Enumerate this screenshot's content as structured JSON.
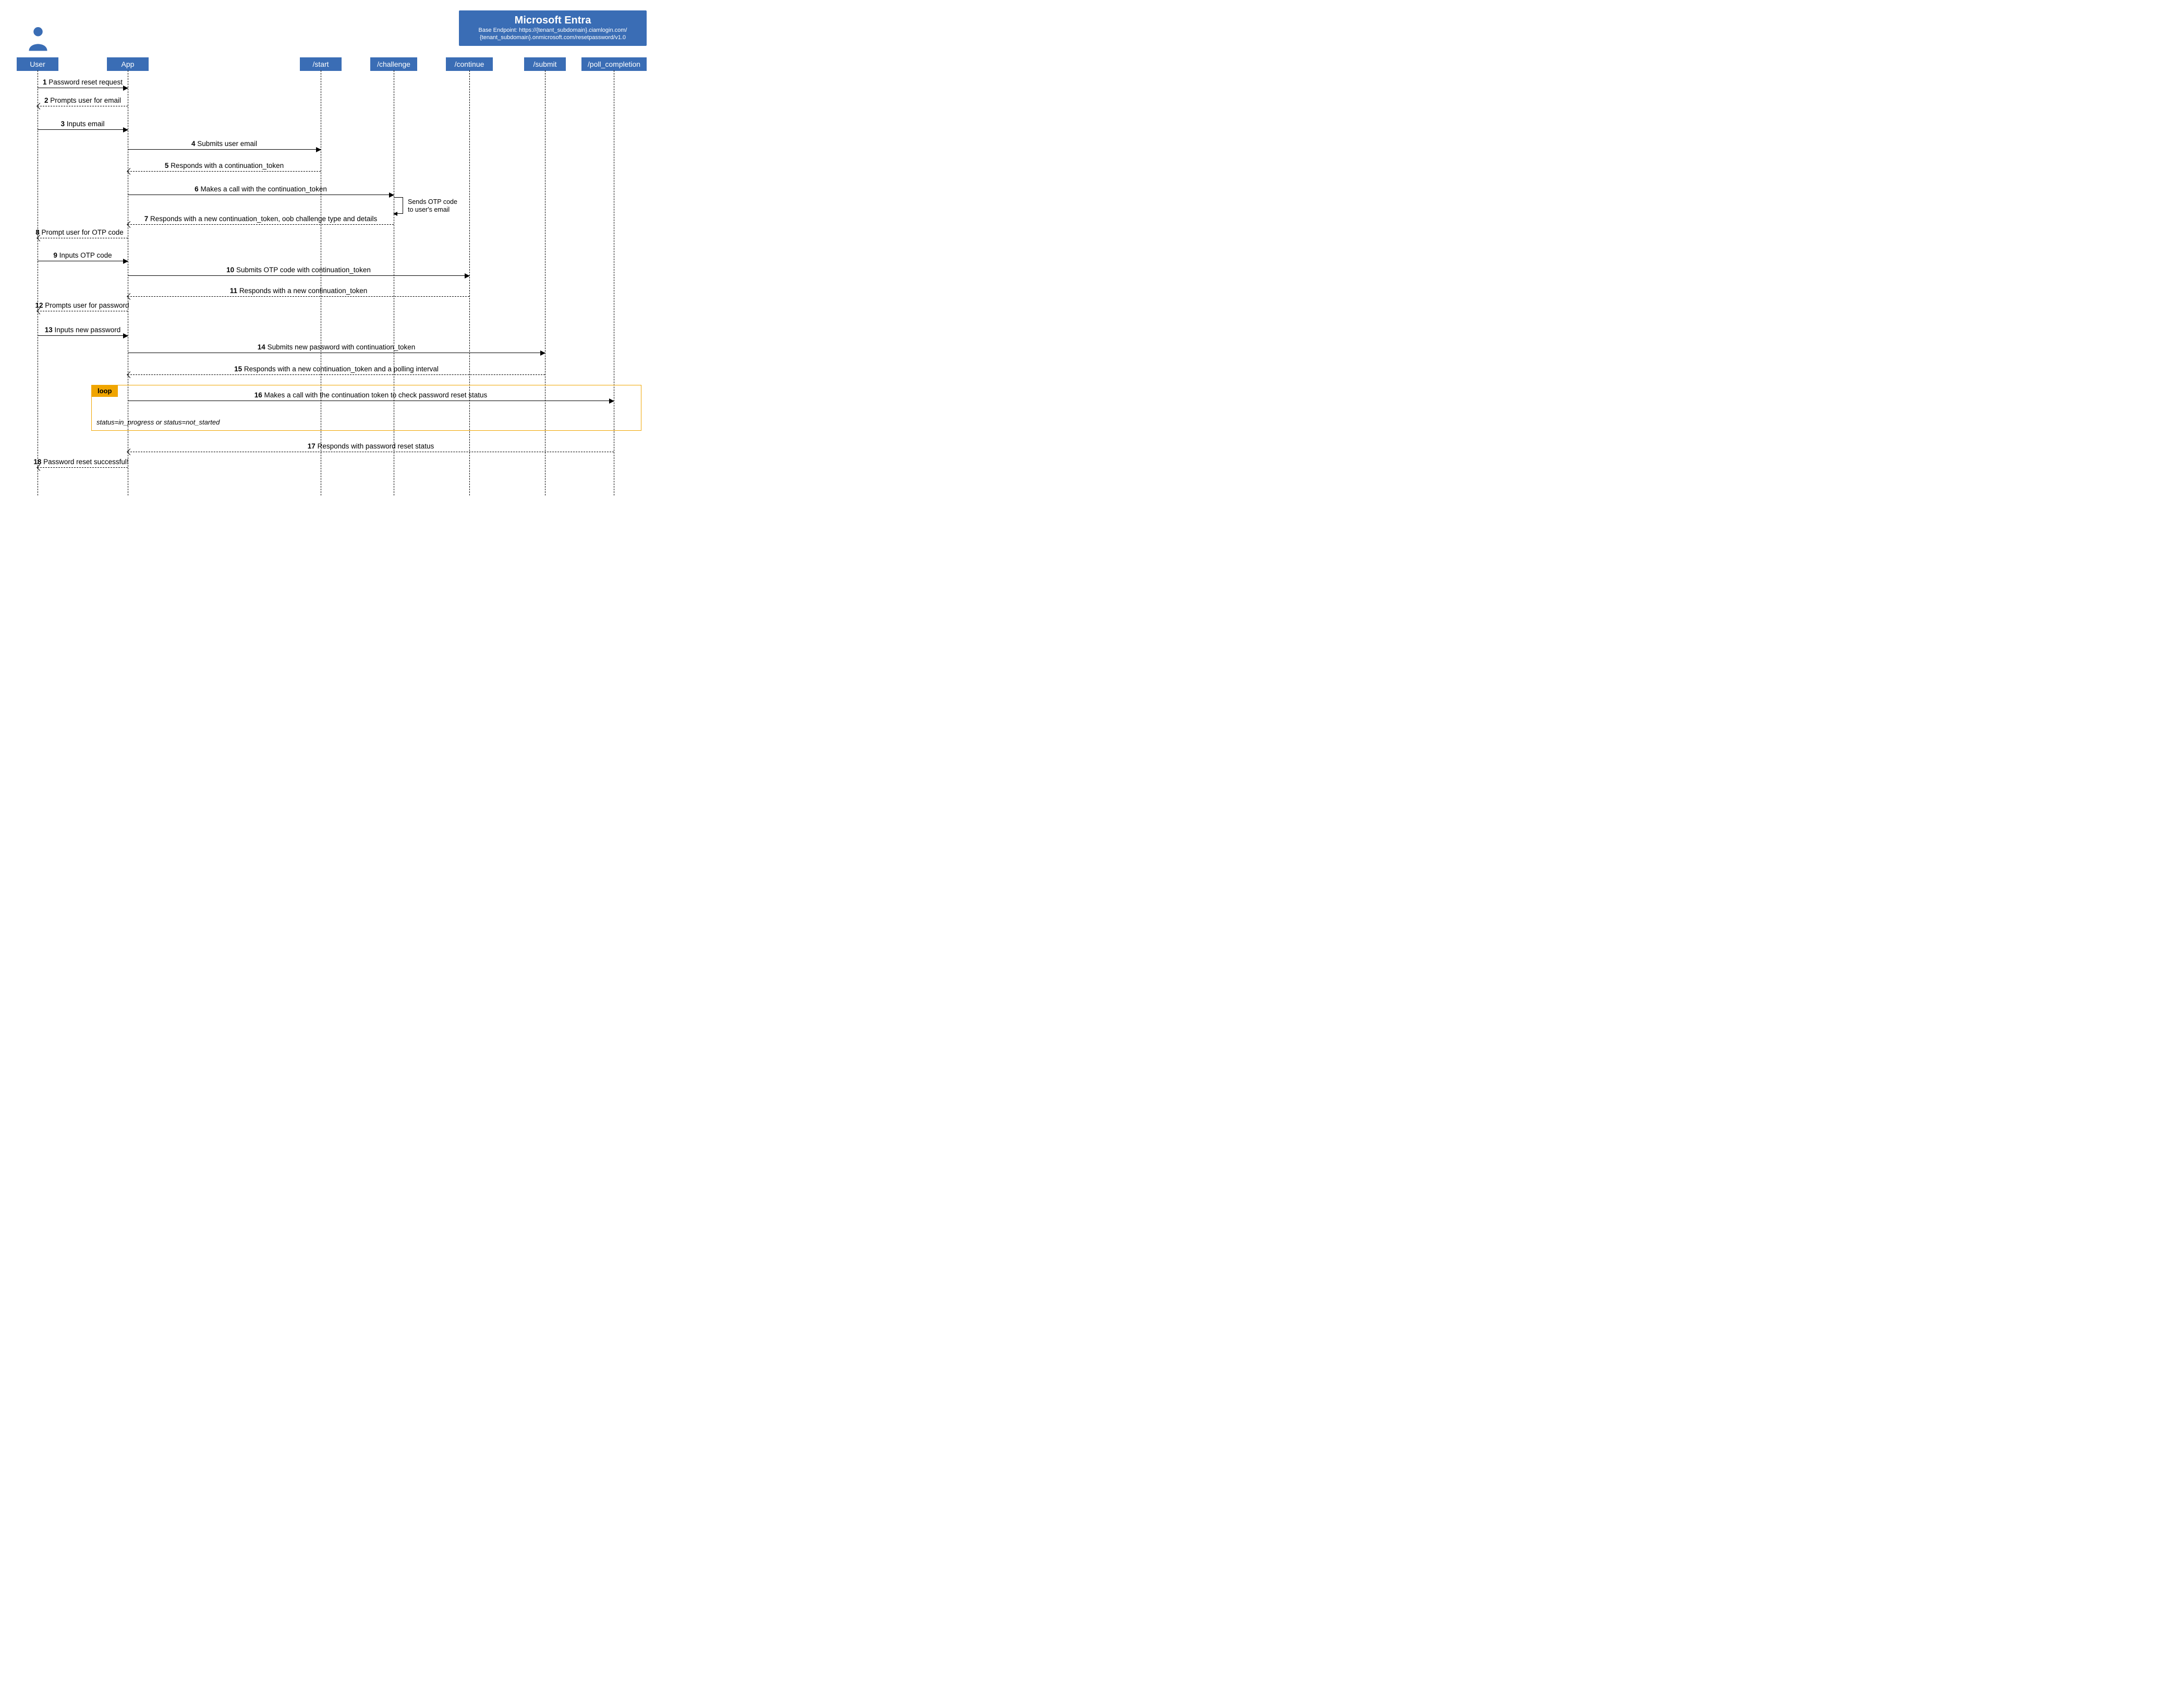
{
  "header": {
    "title": "Microsoft Entra",
    "sub1": "Base Endpoint: https://{tenant_subdomain}.ciamlogin.com/",
    "sub2": "{tenant_subdomain}.onmicrosoft.com/resetpassword/v1.0"
  },
  "participants": {
    "user": "User",
    "app": "App",
    "start": "/start",
    "challenge": "/challenge",
    "continue": "/continue",
    "submit": "/submit",
    "poll": "/poll_completion"
  },
  "messages": {
    "m1": {
      "n": "1",
      "t": "Password reset request"
    },
    "m2": {
      "n": "2",
      "t": "Prompts user for email"
    },
    "m3": {
      "n": "3",
      "t": "Inputs email"
    },
    "m4": {
      "n": "4",
      "t": "Submits user email"
    },
    "m5": {
      "n": "5",
      "t": "Responds with a continuation_token"
    },
    "m6": {
      "n": "6",
      "t": "Makes a call with the continuation_token"
    },
    "m7": {
      "n": "7",
      "t": "Responds with a new continuation_token, oob challenge type and details"
    },
    "m8": {
      "n": "8",
      "t": "Prompt user for OTP code"
    },
    "m9": {
      "n": "9",
      "t": "Inputs OTP code"
    },
    "m10": {
      "n": "10",
      "t": "Submits OTP code with continuation_token"
    },
    "m11": {
      "n": "11",
      "t": "Responds with a new continuation_token"
    },
    "m12": {
      "n": "12",
      "t": "Prompts user for password"
    },
    "m13": {
      "n": "13",
      "t": "Inputs new password"
    },
    "m14": {
      "n": "14",
      "t": "Submits new password with continuation_token"
    },
    "m15": {
      "n": "15",
      "t": "Responds with a new continuation_token and a polling interval"
    },
    "m16": {
      "n": "16",
      "t": "Makes a call with the continuation token to check password reset status"
    },
    "m17": {
      "n": "17",
      "t": "Responds with password reset status"
    },
    "m18": {
      "n": "18",
      "t": "Password reset successful!"
    }
  },
  "self_note": {
    "l1": "Sends OTP code",
    "l2": "to user's email"
  },
  "loop": {
    "tag": "loop",
    "cond": "status=in_progress or status=not_started"
  }
}
